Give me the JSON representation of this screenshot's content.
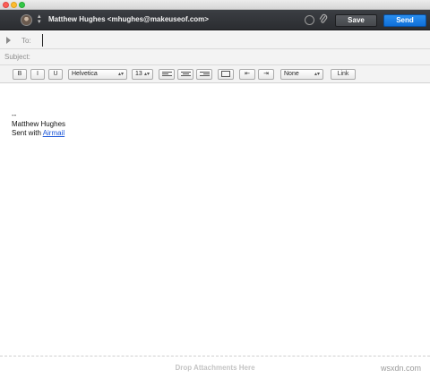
{
  "window": {
    "buttons": [
      "close",
      "minimize",
      "zoom"
    ]
  },
  "header": {
    "from": "Matthew Hughes <mhughes@makeuseof.com>",
    "save_label": "Save",
    "send_label": "Send",
    "icons": [
      "avatar",
      "updown-arrows-icon",
      "loading-icon",
      "paperclip-icon"
    ],
    "send_color": "#1a7fe6"
  },
  "to": {
    "label": "To:",
    "value": ""
  },
  "subject": {
    "label": "Subject:",
    "value": ""
  },
  "toolbar": {
    "bold": "B",
    "italic": "I",
    "underline": "U",
    "font": "Helvetica",
    "size": "13",
    "list_style": "None",
    "link": "Link",
    "icons": [
      "align-left-icon",
      "align-center-icon",
      "align-right-icon",
      "block-quote-icon",
      "outdent-icon",
      "indent-icon"
    ]
  },
  "body": {
    "separator": "--",
    "name": "Matthew Hughes",
    "sent_with": "Sent with ",
    "app_link": "Airmail"
  },
  "attachments": {
    "drop_label": "Drop Attachments Here"
  },
  "watermark": "wsxdn.com"
}
